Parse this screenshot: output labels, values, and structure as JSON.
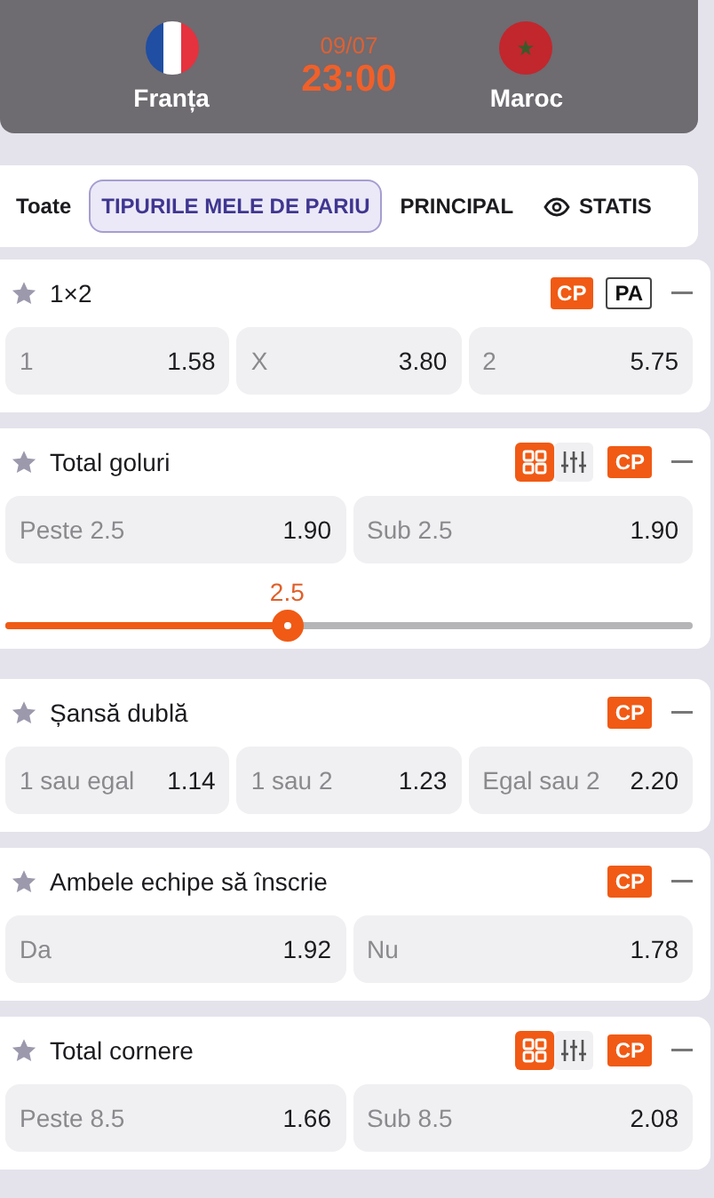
{
  "match": {
    "home": "Franța",
    "date": "09/07",
    "time": "23:00",
    "away": "Maroc"
  },
  "tabs": [
    {
      "label": "Toate",
      "selected": false,
      "kind": "plain"
    },
    {
      "label": "TIPURILE MELE DE PARIU",
      "selected": true,
      "kind": "plain"
    },
    {
      "label": "PRINCIPAL",
      "selected": false,
      "kind": "plain"
    },
    {
      "label": "STATIS",
      "selected": false,
      "kind": "eye"
    }
  ],
  "markets": [
    {
      "title": "1×2",
      "badges": [
        {
          "label": "CP",
          "kind": "filled"
        },
        {
          "label": "PA",
          "kind": "outline"
        }
      ],
      "outcomes": [
        {
          "label": "1",
          "odds": "1.58"
        },
        {
          "label": "X",
          "odds": "3.80"
        },
        {
          "label": "2",
          "odds": "5.75"
        }
      ]
    },
    {
      "title": "Total goluri",
      "toggles": [
        {
          "kind": "grid",
          "selected": true
        },
        {
          "kind": "sliders",
          "selected": false
        }
      ],
      "badges": [
        {
          "label": "CP",
          "kind": "filled"
        }
      ],
      "outcomes": [
        {
          "label": "Peste 2.5",
          "odds": "1.90"
        },
        {
          "label": "Sub 2.5",
          "odds": "1.90"
        }
      ],
      "slider": {
        "value": "2.5",
        "level": 0.41
      }
    },
    {
      "title": "Șansă dublă",
      "badges": [
        {
          "label": "CP",
          "kind": "filled"
        }
      ],
      "outcomes": [
        {
          "label": "1 sau egal",
          "odds": "1.14"
        },
        {
          "label": "1 sau 2",
          "odds": "1.23"
        },
        {
          "label": "Egal sau 2",
          "odds": "2.20"
        }
      ]
    },
    {
      "title": "Ambele echipe să înscrie",
      "badges": [
        {
          "label": "CP",
          "kind": "filled"
        }
      ],
      "outcomes": [
        {
          "label": "Da",
          "odds": "1.92"
        },
        {
          "label": "Nu",
          "odds": "1.78"
        }
      ]
    },
    {
      "title": "Total cornere",
      "toggles": [
        {
          "kind": "grid",
          "selected": true
        },
        {
          "kind": "sliders",
          "selected": false
        }
      ],
      "badges": [
        {
          "label": "CP",
          "kind": "filled"
        }
      ],
      "outcomes": [
        {
          "label": "Peste 8.5",
          "odds": "1.66"
        },
        {
          "label": "Sub 8.5",
          "odds": "2.08"
        }
      ]
    }
  ]
}
